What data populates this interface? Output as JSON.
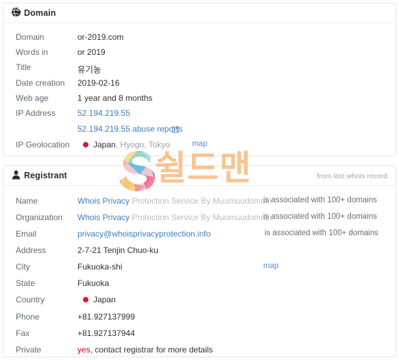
{
  "domain_card": {
    "icon": "globe-icon",
    "title": "Domain",
    "rows": [
      {
        "label": "Domain",
        "value": "or-2019.com"
      },
      {
        "label": "Words in",
        "value": "or 2019"
      },
      {
        "label": "Title",
        "value": "유기농"
      },
      {
        "label": "Date creation",
        "value": "2019-02-16"
      },
      {
        "label": "Web age",
        "value": "1 year and 8 months"
      },
      {
        "label": "IP Address",
        "value": "52.194.219.55"
      },
      {
        "label": "",
        "value": "52.194.219.55 abuse reports"
      },
      {
        "label": "IP Geolocation",
        "value": "Japan",
        "value_rest": ", Hyogo, Tokyo",
        "map_label": "map"
      }
    ]
  },
  "registrant_card": {
    "icon": "user-icon",
    "title": "Registrant",
    "note": "from last whois record",
    "rows": [
      {
        "label": "Name",
        "value_link": "Whois Privacy",
        "value_rest": " Protection Service By Muumuudomain",
        "assoc": "is associated with 100+ domains"
      },
      {
        "label": "Organization",
        "value_link": "Whois Privacy",
        "value_rest": " Protection Service By Muumuudomain",
        "assoc": "is associated with 100+ domains"
      },
      {
        "label": "Email",
        "value_link": "privacy@whoisprivacyprotection.info",
        "assoc": "is associated with 100+ domains"
      },
      {
        "label": "Address",
        "value": "2-7-21 Tenjin Chuo-ku"
      },
      {
        "label": "City",
        "value": "Fukuoka-shi",
        "map_label": "map"
      },
      {
        "label": "State",
        "value": "Fukuoka"
      },
      {
        "label": "Country",
        "value": "Japan",
        "flag": "japan-flag-dot"
      },
      {
        "label": "Phone",
        "value": "+81.927137999"
      },
      {
        "label": "Fax",
        "value": "+81.927137944"
      },
      {
        "label": "Private",
        "value_emph": "yes",
        "value_rest": ", contact registrar for more details"
      }
    ]
  },
  "watermark": {
    "logo_letter": "S",
    "text": "쉴드맨"
  },
  "colors": {
    "link": "#3d7ebd",
    "muted": "#b9bcc0",
    "label": "#5f6a72",
    "danger": "#d0021b",
    "flag": "#d11a3a",
    "watermark_text": "#f7c08a"
  }
}
